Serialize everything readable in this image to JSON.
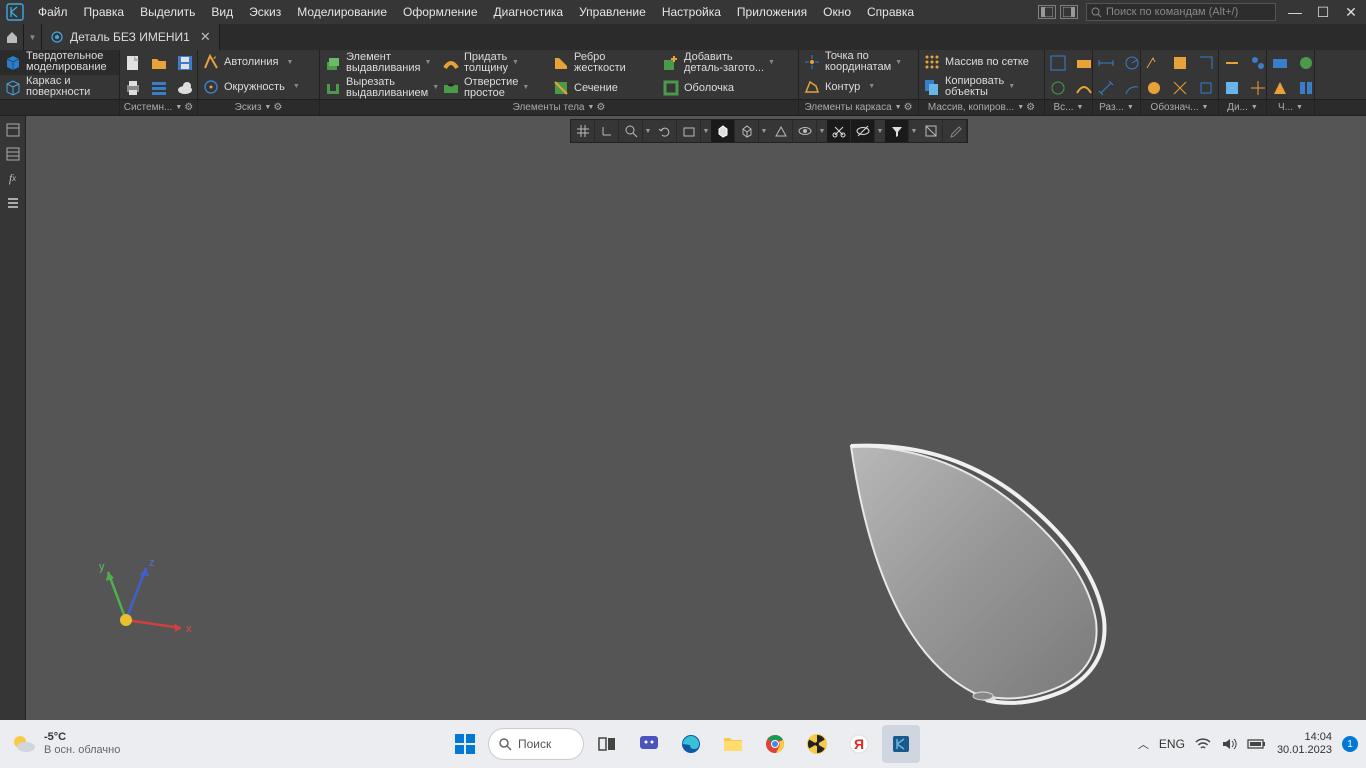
{
  "menubar": {
    "items": [
      "Файл",
      "Правка",
      "Выделить",
      "Вид",
      "Эскиз",
      "Моделирование",
      "Оформление",
      "Диагностика",
      "Управление",
      "Настройка",
      "Приложения",
      "Окно",
      "Справка"
    ],
    "search_placeholder": "Поиск по командам (Alt+/)"
  },
  "tabs": {
    "document": "Деталь БЕЗ ИМЕНИ1"
  },
  "ribbon": {
    "modes": {
      "solid_l1": "Твердотельное",
      "solid_l2": "моделирование",
      "wire_l1": "Каркас и",
      "wire_l2": "поверхности"
    },
    "sketch": {
      "autoline": "Автолиния",
      "circle": "Окружность"
    },
    "body": {
      "extrude_l1": "Элемент",
      "extrude_l2": "выдавливания",
      "cut_l1": "Вырезать",
      "cut_l2": "выдавливанием",
      "thick_l1": "Придать",
      "thick_l2": "толщину",
      "hole_l1": "Отверстие",
      "hole_l2": "простое",
      "rib_l1": "Ребро",
      "rib_l2": "жесткости",
      "section": "Сечение",
      "add_l1": "Добавить",
      "add_l2": "деталь-загото...",
      "shell": "Оболочка"
    },
    "frame": {
      "point_l1": "Точка по",
      "point_l2": "координатам",
      "contour": "Контур"
    },
    "array": {
      "grid": "Массив по сетке",
      "copy_l1": "Копировать",
      "copy_l2": "объекты"
    }
  },
  "bands": [
    "Системн...",
    "Эскиз",
    "Элементы тела",
    "Элементы каркаса",
    "Массив, копиров...",
    "Вс...",
    "Раз...",
    "Обознач...",
    "Ди...",
    "Ч..."
  ],
  "band_widths": [
    78,
    122,
    479,
    121,
    120,
    42,
    42,
    78,
    42,
    40
  ],
  "taskbar": {
    "temp": "-5°C",
    "weather": "В осн. облачно",
    "search": "Поиск",
    "lang": "ENG",
    "time": "14:04",
    "date": "30.01.2023",
    "notif": "1"
  },
  "axis": {
    "x": "x",
    "y": "y",
    "z": "z"
  }
}
